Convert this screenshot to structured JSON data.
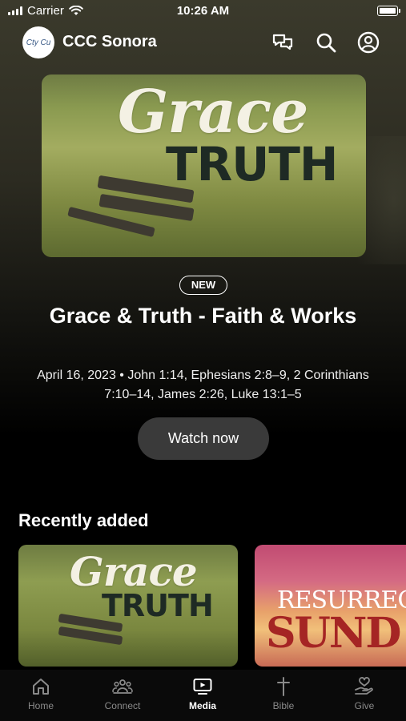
{
  "status_bar": {
    "carrier": "Carrier",
    "time": "10:26 AM"
  },
  "header": {
    "app_title": "CCC Sonora",
    "logo_text": "Cty Cu",
    "icons": [
      "chat-icon",
      "search-icon",
      "profile-icon"
    ]
  },
  "hero": {
    "badge": "NEW",
    "title": "Grace & Truth - Faith & Works",
    "subtitle": "April 16, 2023 • John 1:14, Ephesians 2:8–9, 2 Corinthians 7:10–14, James 2:26, Luke 13:1–5",
    "button_label": "Watch now",
    "art_line1": "Grace",
    "art_line2": "TRUTH"
  },
  "recently_added": {
    "title": "Recently added",
    "cards": [
      {
        "art_line1": "Grace",
        "art_line2": "TRUTH"
      },
      {
        "art_line1": "RESURRECT",
        "art_line2": "SUND"
      }
    ]
  },
  "tabs": [
    {
      "label": "Home",
      "icon": "home-icon",
      "active": false
    },
    {
      "label": "Connect",
      "icon": "people-icon",
      "active": false
    },
    {
      "label": "Media",
      "icon": "media-tv-icon",
      "active": true
    },
    {
      "label": "Bible",
      "icon": "cross-icon",
      "active": false
    },
    {
      "label": "Give",
      "icon": "give-heart-icon",
      "active": false
    }
  ]
}
